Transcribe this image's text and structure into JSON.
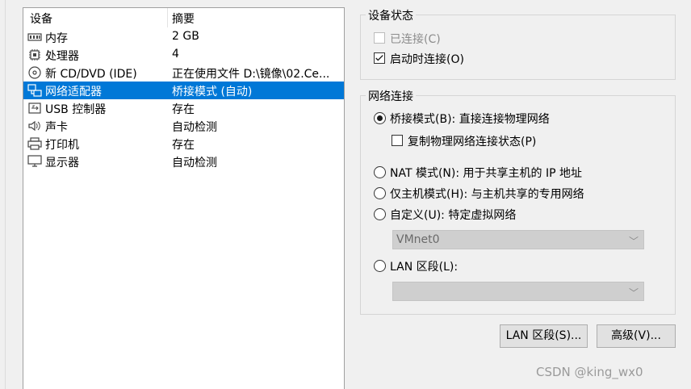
{
  "device_list": {
    "headers": {
      "device": "设备",
      "summary": "摘要"
    },
    "items": [
      {
        "icon": "memory-icon",
        "name": "内存",
        "summary": "2 GB",
        "selected": false
      },
      {
        "icon": "processor-icon",
        "name": "处理器",
        "summary": "4",
        "selected": false
      },
      {
        "icon": "cd-dvd-icon",
        "name": "新 CD/DVD (IDE)",
        "summary": "正在使用文件 D:\\镜像\\02.Ce...",
        "selected": false
      },
      {
        "icon": "network-adapter-icon",
        "name": "网络适配器",
        "summary": "桥接模式 (自动)",
        "selected": true
      },
      {
        "icon": "usb-icon",
        "name": "USB 控制器",
        "summary": "存在",
        "selected": false
      },
      {
        "icon": "sound-icon",
        "name": "声卡",
        "summary": "自动检测",
        "selected": false
      },
      {
        "icon": "printer-icon",
        "name": "打印机",
        "summary": "存在",
        "selected": false
      },
      {
        "icon": "display-icon",
        "name": "显示器",
        "summary": "自动检测",
        "selected": false
      }
    ]
  },
  "device_status": {
    "title": "设备状态",
    "connected": {
      "label": "已连接(C)",
      "checked": false,
      "enabled": false
    },
    "connect_at_power_on": {
      "label": "启动时连接(O)",
      "checked": true,
      "enabled": true
    }
  },
  "network_connection": {
    "title": "网络连接",
    "bridged": {
      "label": "桥接模式(B): 直接连接物理网络",
      "selected": true
    },
    "replicate_state": {
      "label": "复制物理网络连接状态(P)",
      "checked": false
    },
    "nat": {
      "label": "NAT 模式(N): 用于共享主机的 IP 地址",
      "selected": false
    },
    "host_only": {
      "label": "仅主机模式(H): 与主机共享的专用网络",
      "selected": false
    },
    "custom": {
      "label": "自定义(U): 特定虚拟网络",
      "selected": false
    },
    "custom_network_value": "VMnet0",
    "lan_segment": {
      "label": "LAN 区段(L):",
      "selected": false
    },
    "lan_segment_value": ""
  },
  "buttons": {
    "lan_segments": "LAN 区段(S)...",
    "advanced": "高级(V)..."
  },
  "watermark": "CSDN @king_wx0",
  "colors": {
    "selection": "#0078d7",
    "combo_disabled": "#cfcfcf"
  }
}
